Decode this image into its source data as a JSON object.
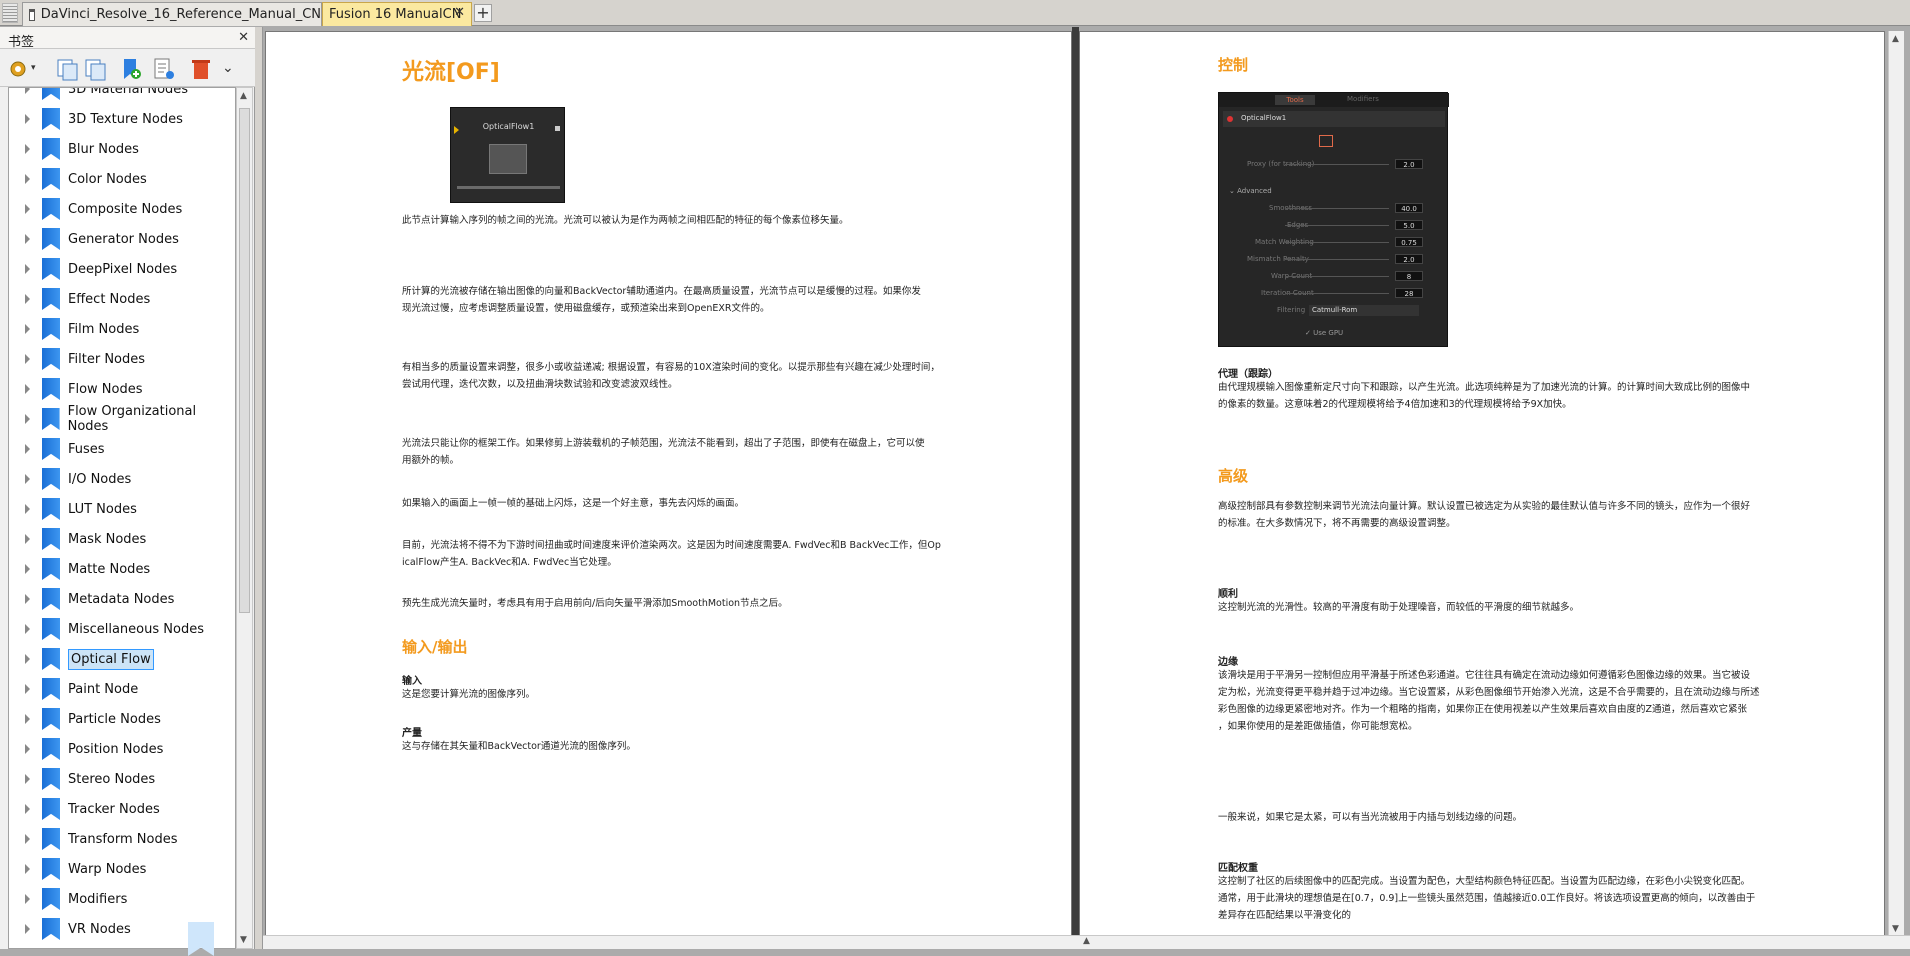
{
  "tabs": [
    {
      "label": "DaVinci_Resolve_16_Reference_Manual_CN"
    },
    {
      "label": "Fusion 16 ManualCN"
    }
  ],
  "sidebar": {
    "title": "书签",
    "items": [
      {
        "label": "3D Material Nodes"
      },
      {
        "label": "3D Texture Nodes"
      },
      {
        "label": "Blur Nodes"
      },
      {
        "label": "Color Nodes"
      },
      {
        "label": "Composite Nodes"
      },
      {
        "label": "Generator Nodes"
      },
      {
        "label": "DeepPixel Nodes"
      },
      {
        "label": "Effect Nodes"
      },
      {
        "label": "Film Nodes"
      },
      {
        "label": "Filter Nodes"
      },
      {
        "label": "Flow Nodes"
      },
      {
        "label": "Flow Organizational Nodes"
      },
      {
        "label": "Fuses"
      },
      {
        "label": "I/O Nodes"
      },
      {
        "label": "LUT Nodes"
      },
      {
        "label": "Mask Nodes"
      },
      {
        "label": "Matte Nodes"
      },
      {
        "label": "Metadata Nodes"
      },
      {
        "label": "Miscellaneous Nodes"
      },
      {
        "label": "Optical Flow"
      },
      {
        "label": "Paint Node"
      },
      {
        "label": "Particle Nodes"
      },
      {
        "label": "Position Nodes"
      },
      {
        "label": "Stereo Nodes"
      },
      {
        "label": "Tracker Nodes"
      },
      {
        "label": "Transform Nodes"
      },
      {
        "label": "Warp Nodes"
      },
      {
        "label": "Modifiers"
      },
      {
        "label": "VR Nodes"
      }
    ],
    "selected": "Optical Flow"
  },
  "left_page": {
    "heading": "光流[OF]",
    "node_label": "OpticalFlow1",
    "p1": "此节点计算输入序列的帧之间的光流。光流可以被认为是作为两帧之间相匹配的特征的每个像素位移矢量。",
    "p2a": "所计算的光流被存储在输出图像的向量和BackVector辅助通道内。在最高质量设置，光流节点可以是缓慢的过程。如果你发",
    "p2b": "现光流过慢，应考虑调整质量设置，使用磁盘缓存，或预渲染出来到OpenEXR文件的。",
    "p3a": "有相当多的质量设置来调整，很多小或收益递减; 根据设置，有容易的10X渲染时间的变化。以提示那些有兴趣在减少处理时间，",
    "p3b": "尝试用代理，迭代次数，以及扭曲滑块数试验和改变滤波双线性。",
    "p4a": "光流法只能让你的框架工作。如果修剪上游装载机的子帧范围，光流法不能看到，超出了子范围，即使有在磁盘上，它可以使",
    "p4b": "用额外的帧。",
    "p5": "如果输入的画面上一帧一帧的基础上闪烁，这是一个好主意，事先去闪烁的画面。",
    "p6a": "目前，光流法将不得不为下游时间扭曲或时间速度来评价渲染两次。这是因为时间速度需要A. FwdVec和B BackVec工作，但Op",
    "p6b": "icalFlow产生A. BackVec和A. FwdVec当它处理。",
    "p7": "预先生成光流矢量时，考虑具有用于启用前向/后向矢量平滑添加SmoothMotion节点之后。",
    "io_heading": "输入/输出",
    "input_title": "输入",
    "input_text": "这是您要计算光流的图像序列。",
    "output_title": "产量",
    "output_text": "这与存储在其矢量和BackVector通道光流的图像序列。"
  },
  "right_page": {
    "heading": "控制",
    "insp": {
      "tab_tools": "Tools",
      "tab_modifiers": "Modifiers",
      "node": "OpticalFlow1",
      "proxy_label": "Proxy (for tracking)",
      "proxy_value": "2.0",
      "advanced": "Advanced",
      "rows": [
        {
          "label": "Smoothness",
          "value": "40.0"
        },
        {
          "label": "Edges",
          "value": "5.0"
        },
        {
          "label": "Match Weighting",
          "value": "0.75"
        },
        {
          "label": "Mismatch Penalty",
          "value": "2.0"
        },
        {
          "label": "Warp Count",
          "value": "8"
        },
        {
          "label": "Iteration Count",
          "value": "28"
        }
      ],
      "filtering_label": "Filtering",
      "filtering_value": "Catmull-Rom",
      "use_gpu": "Use GPU"
    },
    "proxy_title": "代理（跟踪）",
    "proxy_a": "由代理规模输入图像重新定尺寸向下和跟踪，以产生光流。此选项纯粹是为了加速光流的计算。的计算时间大致成比例的图像中",
    "proxy_b": "的像素的数量。这意味着2的代理规模将给予4倍加速和3的代理规模将给予9X加快。",
    "adv_heading": "高级",
    "adv_a": "高级控制部具有参数控制来调节光流法向量计算。默认设置已被选定为从实验的最佳默认值与许多不同的镜头，应作为一个很好",
    "adv_b": "的标准。在大多数情况下，将不再需要的高级设置调整。",
    "smooth_title": "顺利",
    "smooth_text": "这控制光流的光滑性。较高的平滑度有助于处理噪音，而较低的平滑度的细节就越多。",
    "edges_title": "边缘",
    "edges_a": "该滑块是用于平滑另一控制但应用平滑基于所述色彩通道。它往往具有确定在流动边缘如何遵循彩色图像边缘的效果。当它被设",
    "edges_b": "定为松，光流变得更平稳并趋于过冲边缘。当它设置紧，从彩色图像细节开始渗入光流，这是不合乎需要的，且在流动边缘与所述",
    "edges_c": "彩色图像的边缘更紧密地对齐。作为一个粗略的指南，如果你正在使用视差以产生效果后喜欢自由度的Z通道，然后喜欢它紧张",
    "edges_d": "，如果你使用的是差距做插值，你可能想宽松。",
    "edges_e": "一般来说，如果它是太紧，可以有当光流被用于内插与划线边缘的问题。",
    "mw_title": "匹配权重",
    "mw_a": "这控制了社区的后续图像中的匹配完成。当设置为配色，大型结构颜色特征匹配。当设置为匹配边缘，在彩色小尖锐变化匹配。",
    "mw_b": "通常，用于此滑块的理想值是在[0.7，0.9]上一些镜头虽然范围，值越接近0.0工作良好。将该选项设置更高的倾向，以改善由于",
    "mw_c": "差异存在匹配结果以平滑变化的"
  }
}
